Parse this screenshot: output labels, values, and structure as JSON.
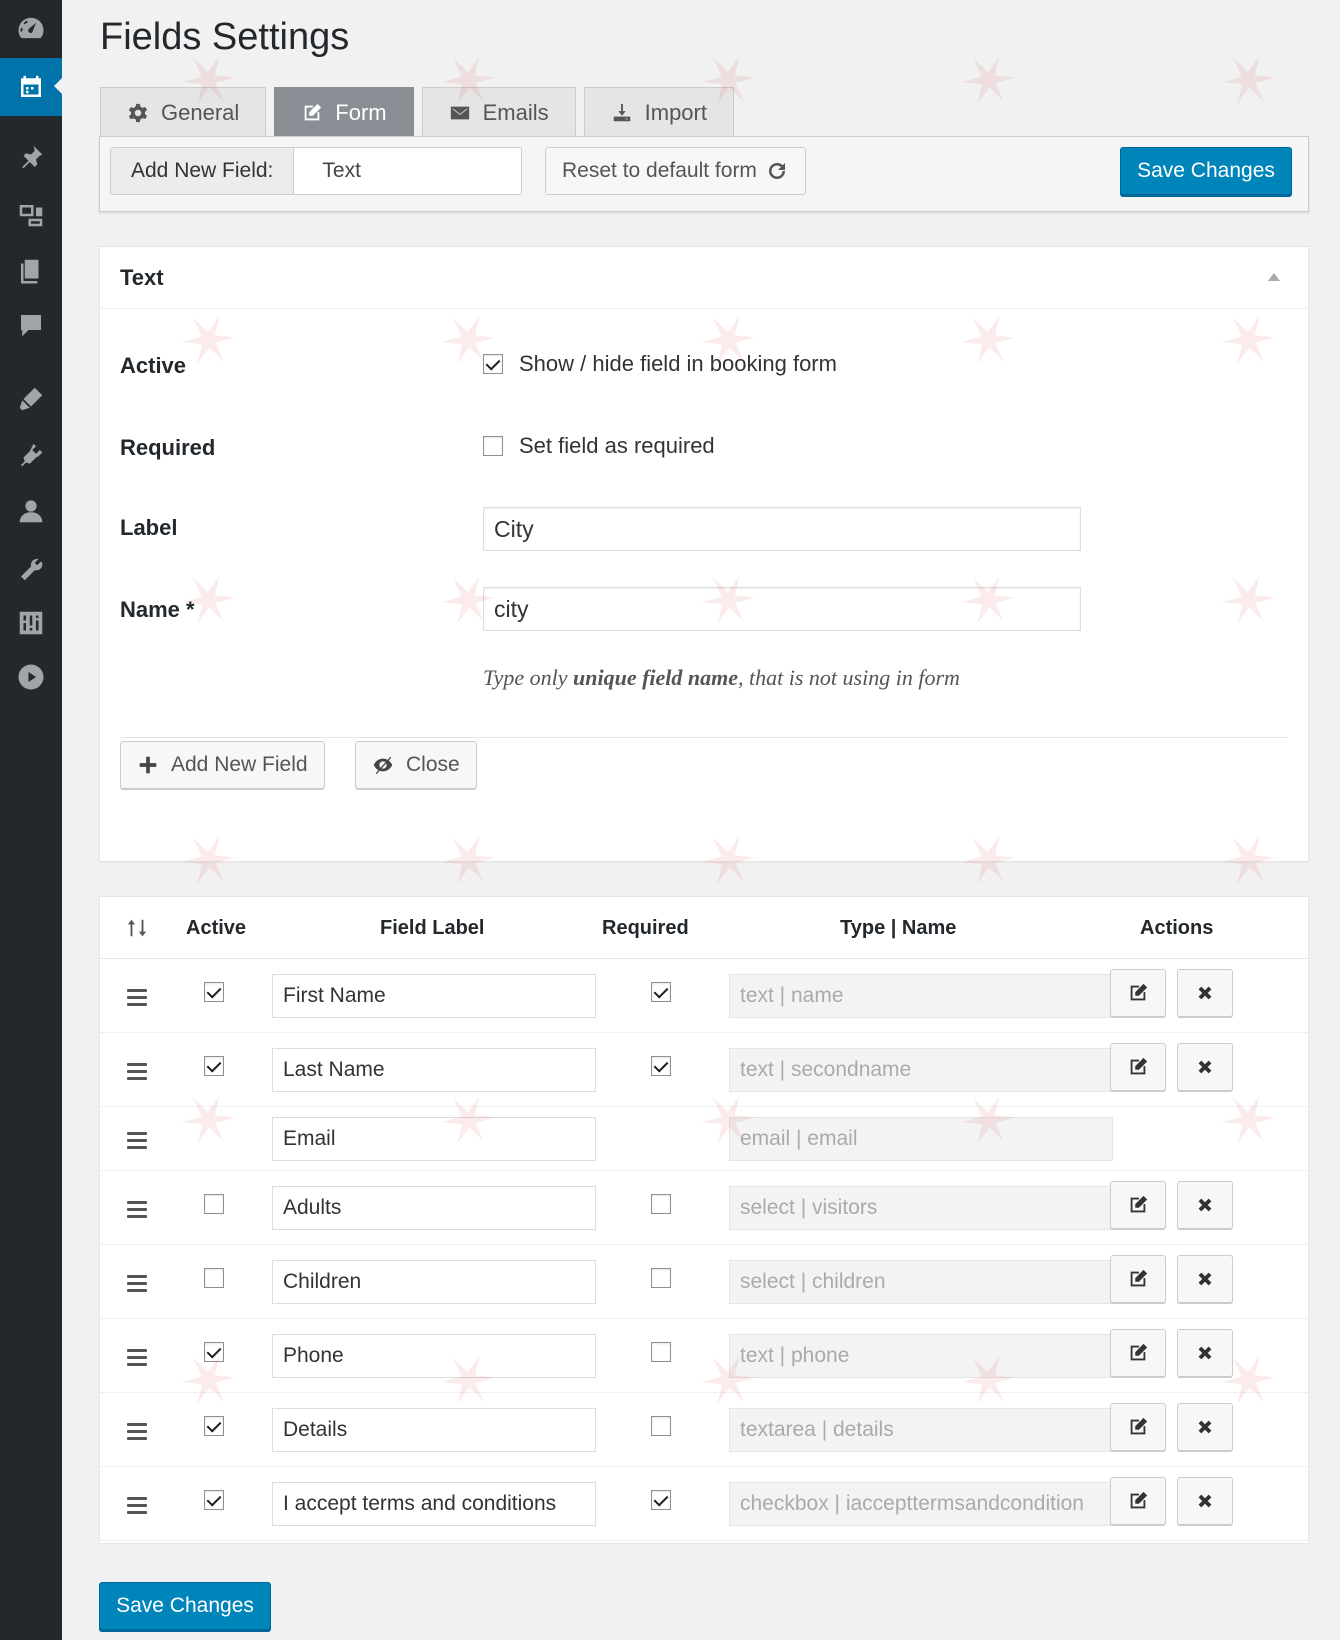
{
  "page": {
    "title": "Fields Settings",
    "accent": "#0085ba",
    "sidebar_bg": "#23282d"
  },
  "sidebar": {
    "items": [
      {
        "icon": "dashboard-icon"
      },
      {
        "icon": "calendar-icon",
        "active": true
      },
      {
        "icon": "pin-icon"
      },
      {
        "icon": "media-icon"
      },
      {
        "icon": "pages-icon"
      },
      {
        "icon": "comments-icon"
      },
      {
        "icon": "appearance-icon"
      },
      {
        "icon": "plugins-icon"
      },
      {
        "icon": "users-icon"
      },
      {
        "icon": "tools-icon"
      },
      {
        "icon": "settings-icon"
      },
      {
        "icon": "play-icon"
      }
    ]
  },
  "tabs": [
    {
      "label": "General",
      "icon": "gear-icon"
    },
    {
      "label": "Form",
      "icon": "edit-icon",
      "active": true
    },
    {
      "label": "Emails",
      "icon": "envelope-icon"
    },
    {
      "label": "Import",
      "icon": "import-icon"
    }
  ],
  "toolbar": {
    "add_label": "Add New Field:",
    "add_value": "Text",
    "reset_label": "Reset to default form",
    "save_label": "Save Changes"
  },
  "edit_panel": {
    "title": "Text",
    "active_label": "Active",
    "active_text": "Show / hide field in booking form",
    "active_checked": true,
    "required_label": "Required",
    "required_text": "Set field as required",
    "required_checked": false,
    "label_label": "Label",
    "label_value": "City",
    "name_label": "Name *",
    "name_value": "city",
    "help_pre": "Type only",
    "help_bold": "unique field name",
    "help_post": ", that is not using in form",
    "add_button": "Add New Field",
    "close_button": "Close"
  },
  "table": {
    "headers": {
      "active": "Active",
      "field_label": "Field Label",
      "required": "Required",
      "type_name": "Type | Name",
      "actions": "Actions"
    },
    "rows": [
      {
        "label": "First Name",
        "type": "text | name",
        "active": true,
        "required": true,
        "has_controls": true
      },
      {
        "label": "Last Name",
        "type": "text | secondname",
        "active": true,
        "required": true,
        "has_controls": true
      },
      {
        "label": "Email",
        "type": "email | email",
        "active": null,
        "required": null,
        "has_controls": false
      },
      {
        "label": "Adults",
        "type": "select | visitors",
        "active": false,
        "required": false,
        "has_controls": true
      },
      {
        "label": "Children",
        "type": "select | children",
        "active": false,
        "required": false,
        "has_controls": true
      },
      {
        "label": "Phone",
        "type": "text | phone",
        "active": true,
        "required": false,
        "has_controls": true
      },
      {
        "label": "Details",
        "type": "textarea | details",
        "active": true,
        "required": false,
        "has_controls": true
      },
      {
        "label": "I accept terms and conditions",
        "type": "checkbox | iaccepttermsandcondition",
        "active": true,
        "required": true,
        "has_controls": true
      }
    ]
  },
  "footer": {
    "save_label": "Save Changes"
  }
}
